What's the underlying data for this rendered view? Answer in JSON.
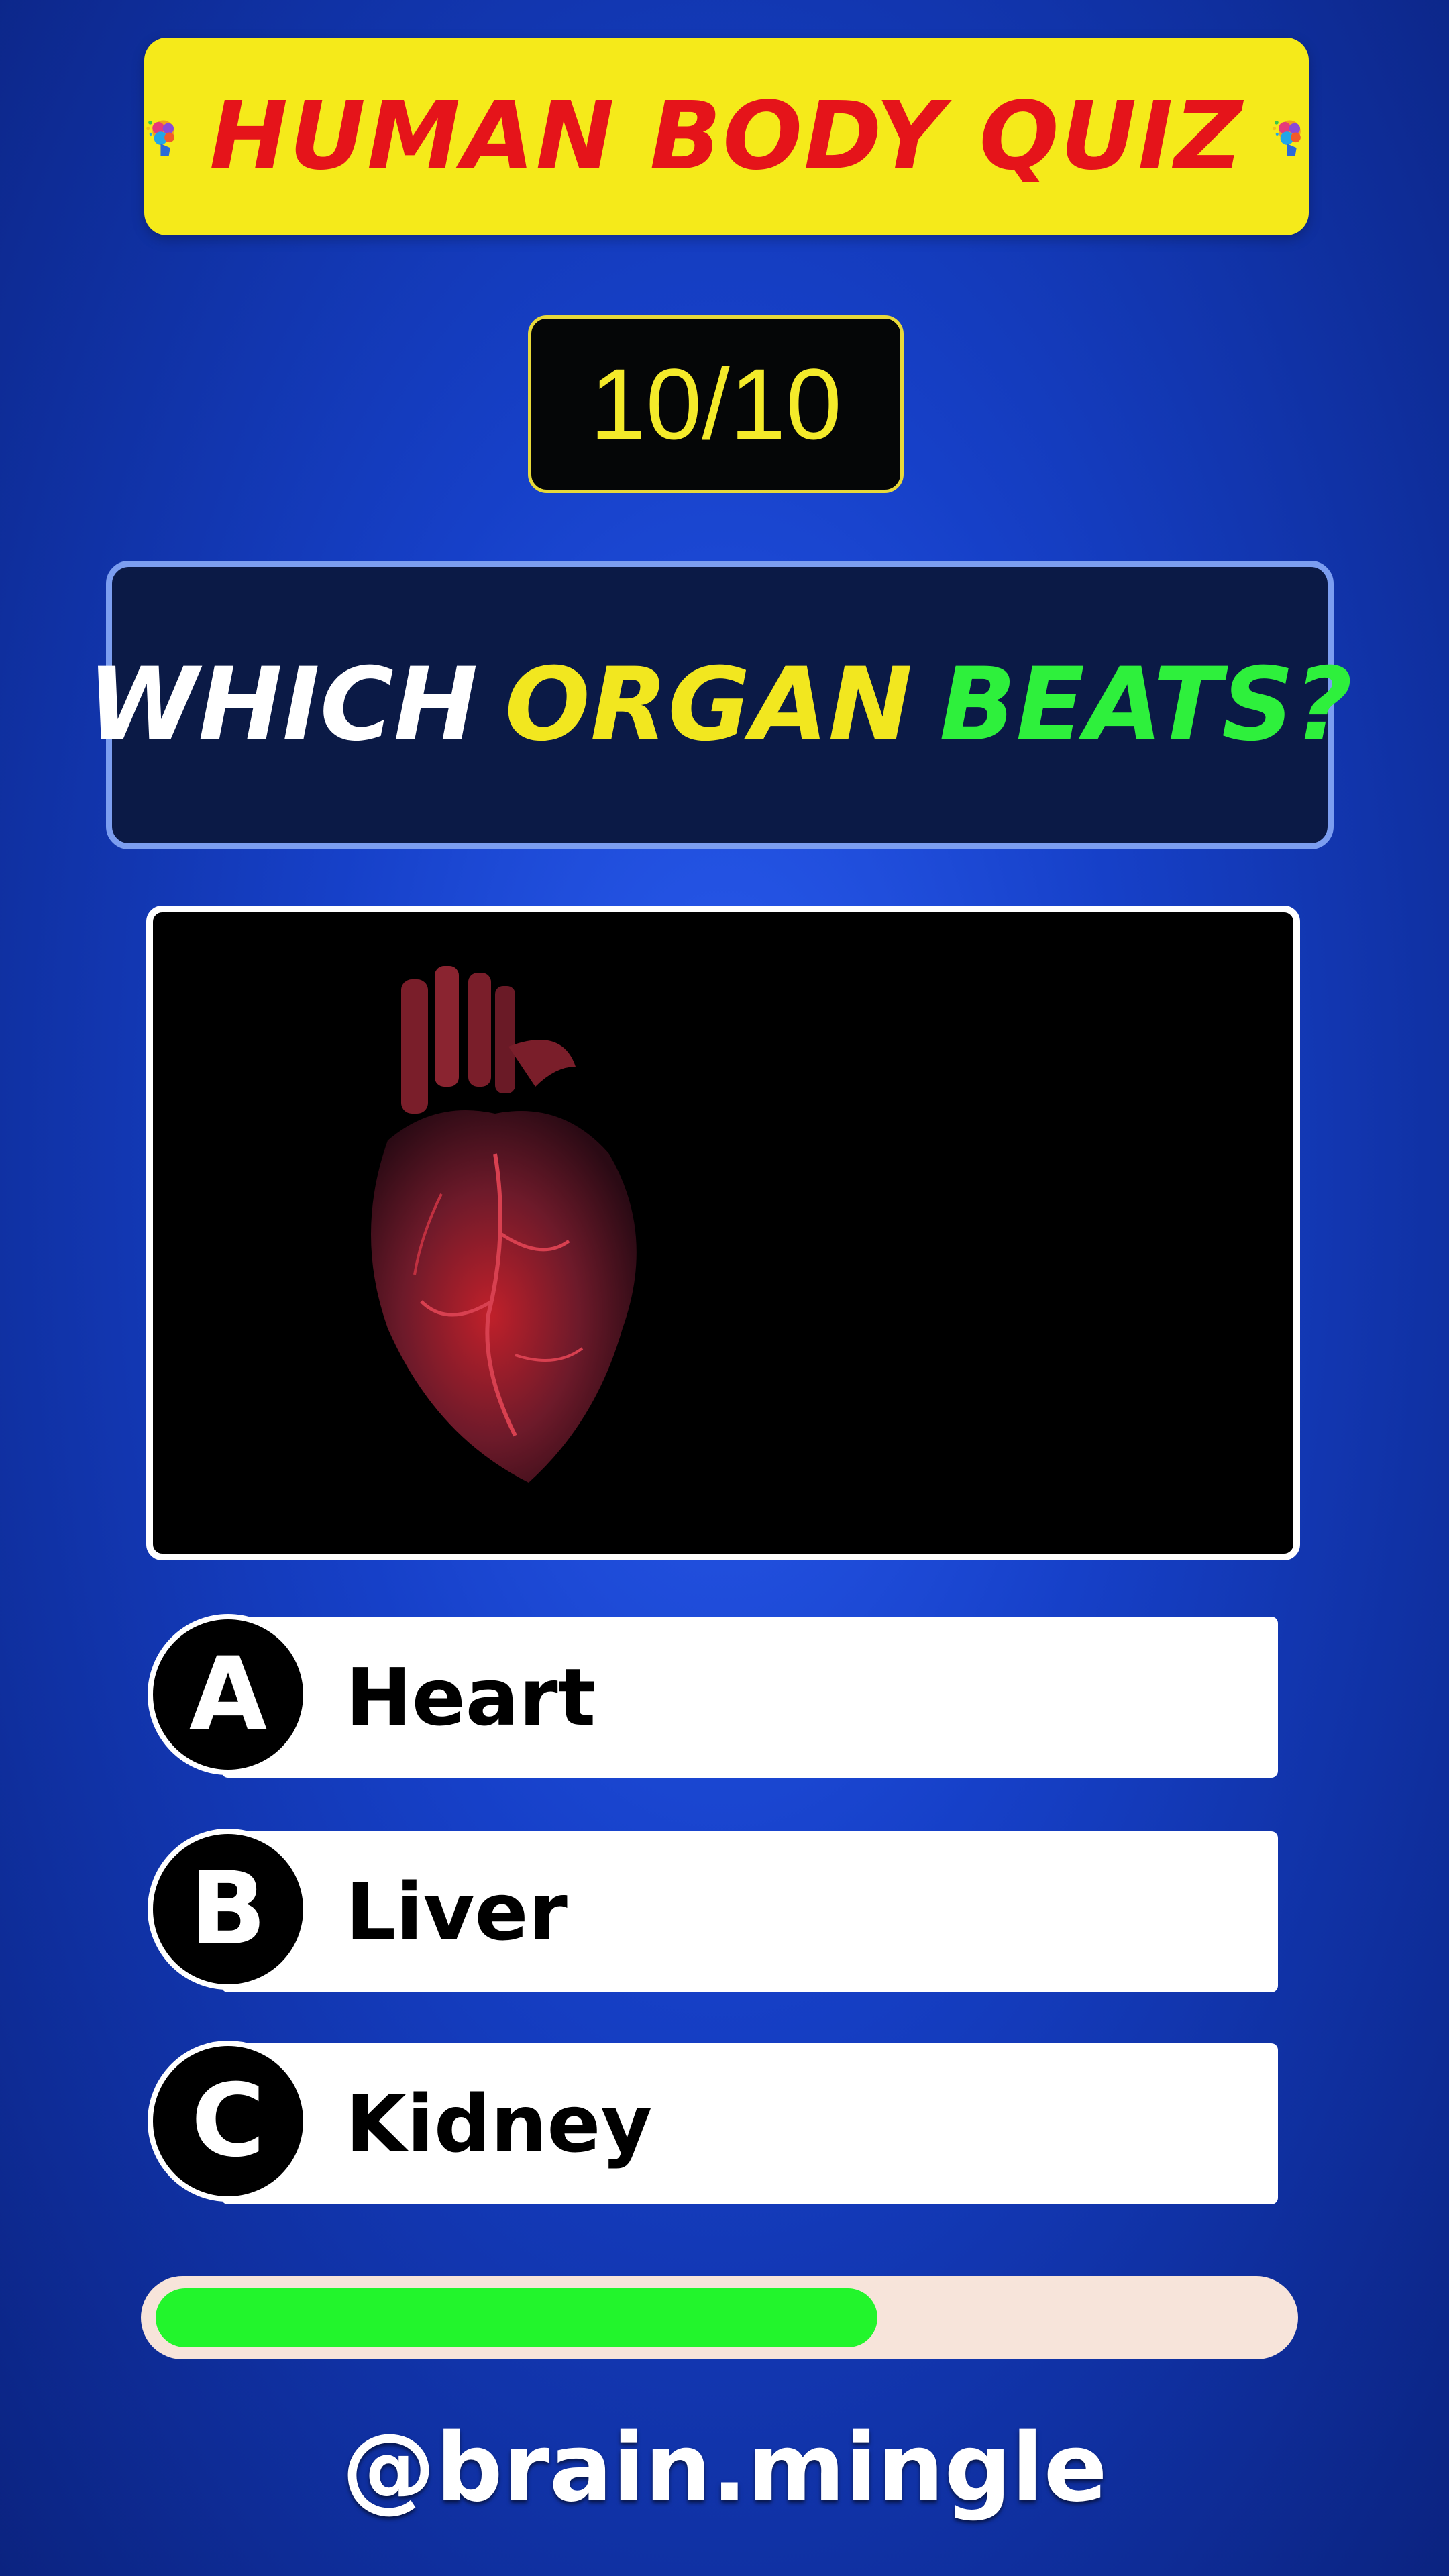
{
  "header": {
    "title": "HUMAN BODY QUIZ",
    "left_icon": "brain-icon",
    "right_icon": "brain-icon"
  },
  "counter": {
    "text": "10/10"
  },
  "question": {
    "word1": "WHICH",
    "word2": "ORGAN",
    "word3": "BEATS?",
    "colors": {
      "word1": "#ffffff",
      "word2": "#f2e71f",
      "word3": "#2ef03c"
    }
  },
  "image": {
    "subject_icon": "heart-icon"
  },
  "options": [
    {
      "letter": "A",
      "label": "Heart"
    },
    {
      "letter": "B",
      "label": "Liver"
    },
    {
      "letter": "C",
      "label": "Kidney"
    }
  ],
  "progress": {
    "fraction": 0.64,
    "color": "#22f52c"
  },
  "footer": {
    "handle": "@brain.mingle"
  },
  "colors": {
    "background": "#1640c8",
    "banner": "#f5ea1a",
    "title_text": "#e5141a",
    "counter_text": "#f4ea2a"
  }
}
